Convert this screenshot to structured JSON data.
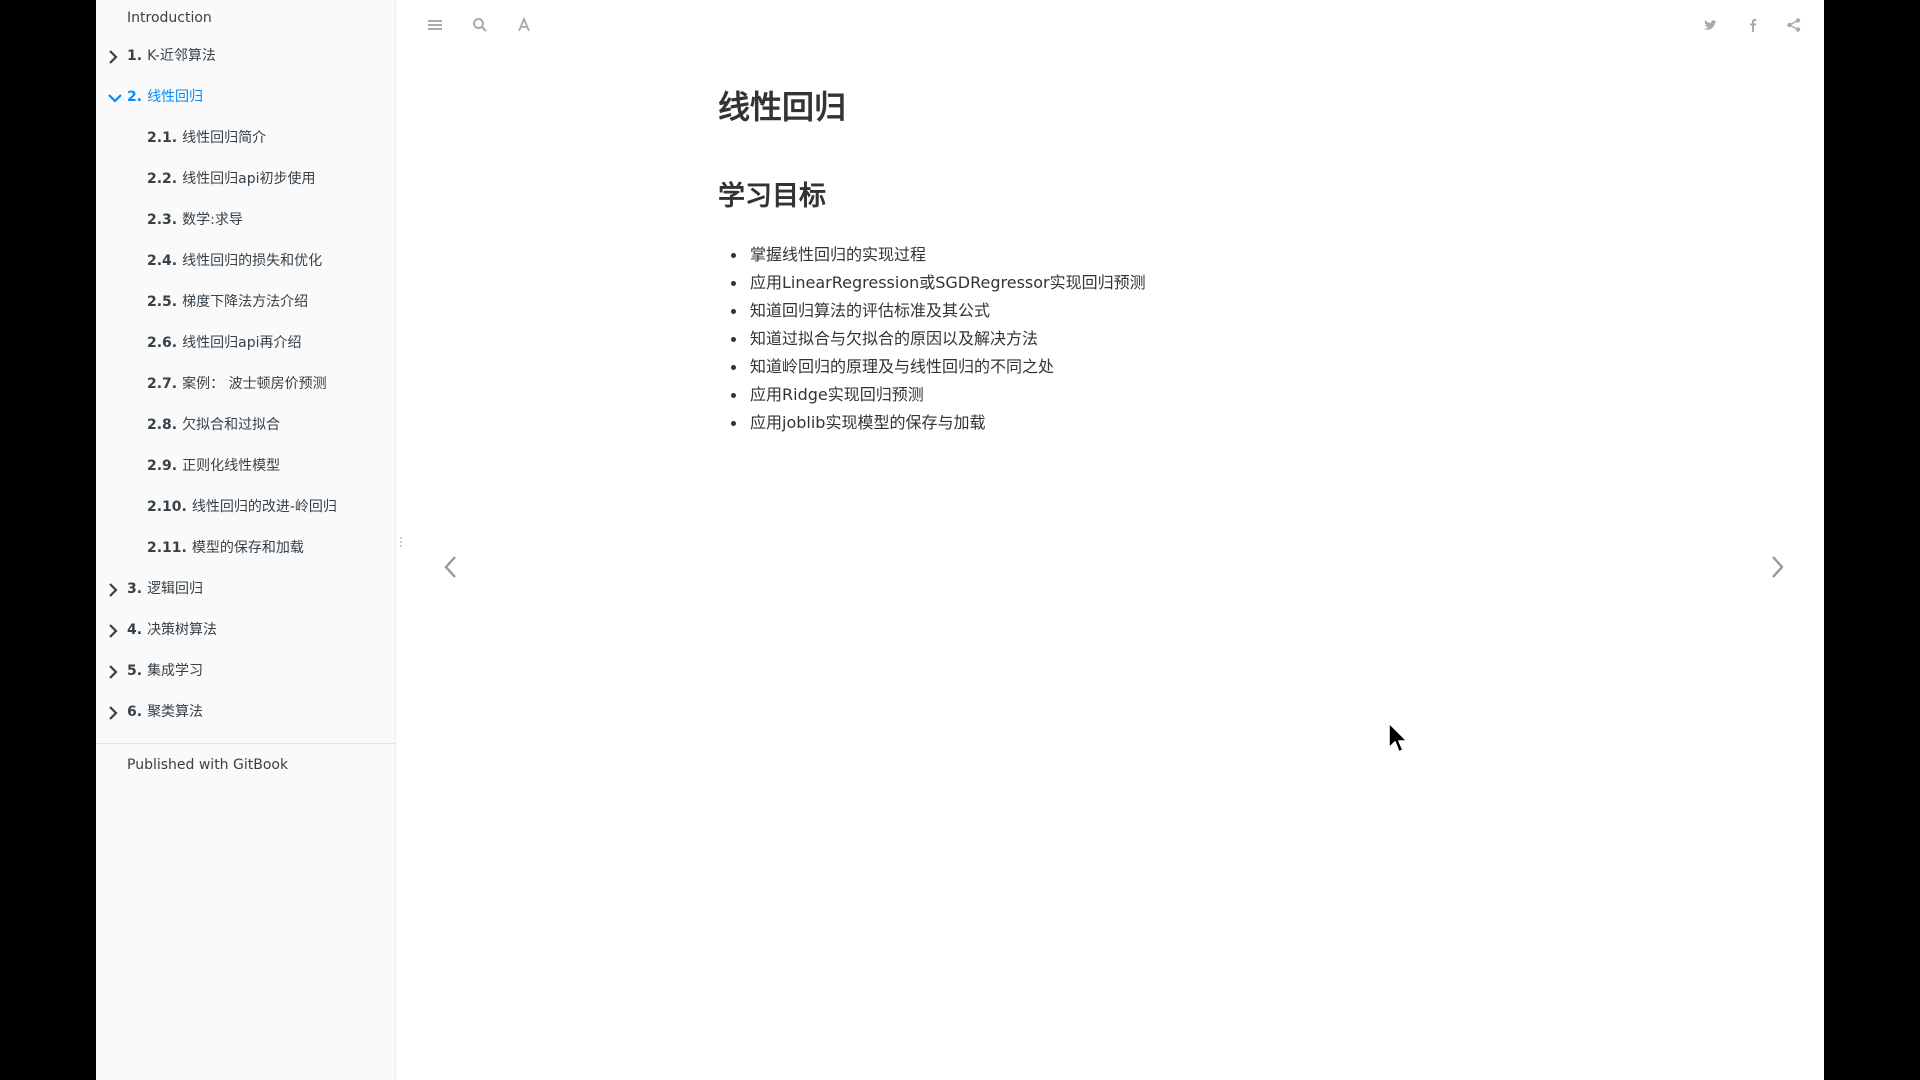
{
  "sidebar": {
    "intro": "Introduction",
    "chapters": [
      {
        "num": "1.",
        "title": "K-近邻算法",
        "expanded": false
      },
      {
        "num": "2.",
        "title": "线性回归",
        "expanded": true,
        "active": true
      },
      {
        "num": "3.",
        "title": "逻辑回归",
        "expanded": false
      },
      {
        "num": "4.",
        "title": "决策树算法",
        "expanded": false
      },
      {
        "num": "5.",
        "title": "集成学习",
        "expanded": false
      },
      {
        "num": "6.",
        "title": "聚类算法",
        "expanded": false
      }
    ],
    "sections": [
      {
        "num": "2.1.",
        "title": "线性回归简介"
      },
      {
        "num": "2.2.",
        "title": "线性回归api初步使用"
      },
      {
        "num": "2.3.",
        "title": "数学:求导"
      },
      {
        "num": "2.4.",
        "title": "线性回归的损失和优化"
      },
      {
        "num": "2.5.",
        "title": "梯度下降法方法介绍"
      },
      {
        "num": "2.6.",
        "title": "线性回归api再介绍"
      },
      {
        "num": "2.7.",
        "title": "案例：  波士顿房价预测"
      },
      {
        "num": "2.8.",
        "title": "欠拟合和过拟合"
      },
      {
        "num": "2.9.",
        "title": "正则化线性模型"
      },
      {
        "num": "2.10.",
        "title": "线性回归的改进-岭回归"
      },
      {
        "num": "2.11.",
        "title": "模型的保存和加载"
      }
    ],
    "published": "Published with GitBook"
  },
  "toolbar": {
    "left_icons": [
      "menu-icon",
      "search-icon",
      "font-settings-icon"
    ],
    "right_icons": [
      "twitter-icon",
      "facebook-icon",
      "share-icon"
    ]
  },
  "content": {
    "title": "线性回归",
    "section_title": "学习目标",
    "objectives": [
      "掌握线性回归的实现过程",
      "应用LinearRegression或SGDRegressor实现回归预测",
      "知道回归算法的评估标准及其公式",
      "知道过拟合与欠拟合的原因以及解决方法",
      "知道岭回归的原理及与线性回归的不同之处",
      "应用Ridge实现回归预测",
      "应用joblib实现模型的保存与加载"
    ]
  },
  "colors": {
    "active": "#008cff",
    "sidebar_text": "#364149",
    "icon": "#aaaaaa"
  }
}
